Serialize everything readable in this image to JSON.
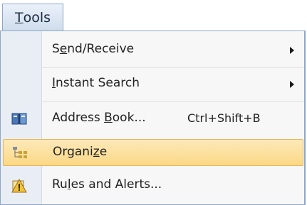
{
  "menu_bar": {
    "tools": {
      "first": "T",
      "rest": "ools"
    }
  },
  "menu": {
    "send_receive": {
      "pre": "S",
      "u": "e",
      "post": "nd/Receive"
    },
    "instant_search": {
      "pre": "",
      "u": "I",
      "post": "nstant Search"
    },
    "address_book": {
      "pre": "Address ",
      "u": "B",
      "post": "ook...",
      "shortcut": "Ctrl+Shift+B"
    },
    "organize": {
      "pre": "Organi",
      "u": "z",
      "post": "e"
    },
    "rules_alerts": {
      "pre": "Ru",
      "u": "l",
      "post": "es and Alerts..."
    }
  },
  "icons": {
    "address_book": "address-book-icon",
    "organize": "organize-icon",
    "rules_alerts": "rules-alerts-icon",
    "submenu": "submenu-arrow-icon"
  },
  "colors": {
    "highlight": "#fbd886",
    "menu_background": "#f7f7f7",
    "border": "#8ea7c7"
  }
}
